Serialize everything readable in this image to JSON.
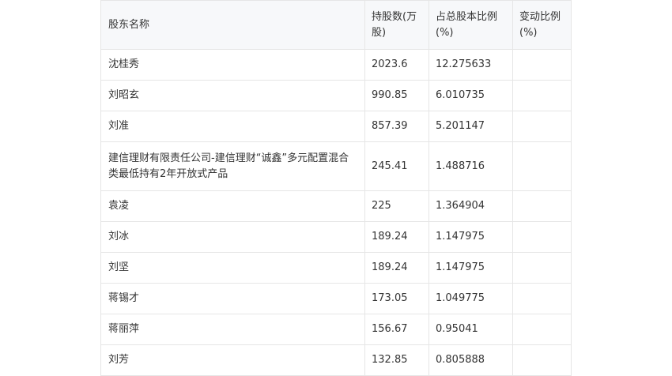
{
  "table": {
    "headers": [
      "股东名称",
      "持股数(万股)",
      "占总股本比例(%)",
      "变动比例(%)"
    ],
    "rows": [
      {
        "name": "沈桂秀",
        "shares": "2023.6",
        "ratio": "12.275633",
        "change": ""
      },
      {
        "name": "刘昭玄",
        "shares": "990.85",
        "ratio": "6.010735",
        "change": ""
      },
      {
        "name": "刘准",
        "shares": "857.39",
        "ratio": "5.201147",
        "change": ""
      },
      {
        "name": "建信理财有限责任公司-建信理财“诚鑫”多元配置混合类最低持有2年开放式产品",
        "shares": "245.41",
        "ratio": "1.488716",
        "change": ""
      },
      {
        "name": "袁凌",
        "shares": "225",
        "ratio": "1.364904",
        "change": ""
      },
      {
        "name": "刘冰",
        "shares": "189.24",
        "ratio": "1.147975",
        "change": ""
      },
      {
        "name": "刘坚",
        "shares": "189.24",
        "ratio": "1.147975",
        "change": ""
      },
      {
        "name": "蒋锡才",
        "shares": "173.05",
        "ratio": "1.049775",
        "change": ""
      },
      {
        "name": "蒋丽萍",
        "shares": "156.67",
        "ratio": "0.95041",
        "change": ""
      },
      {
        "name": "刘芳",
        "shares": "132.85",
        "ratio": "0.805888",
        "change": ""
      }
    ]
  }
}
